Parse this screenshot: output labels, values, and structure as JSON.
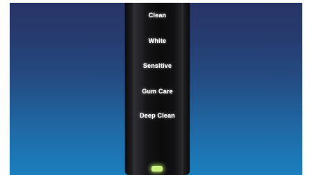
{
  "handle": {
    "modes": [
      {
        "label": "Clean"
      },
      {
        "label": "White"
      },
      {
        "label": "Sensitive"
      },
      {
        "label": "Gum Care"
      },
      {
        "label": "Deep Clean"
      }
    ],
    "battery_indicator": {
      "color": "#c9f27a"
    }
  },
  "colors": {
    "background_top": "#283466",
    "background_bottom": "#1b7fbe",
    "handle": "#101012",
    "label_text": "#f4f4f4"
  }
}
